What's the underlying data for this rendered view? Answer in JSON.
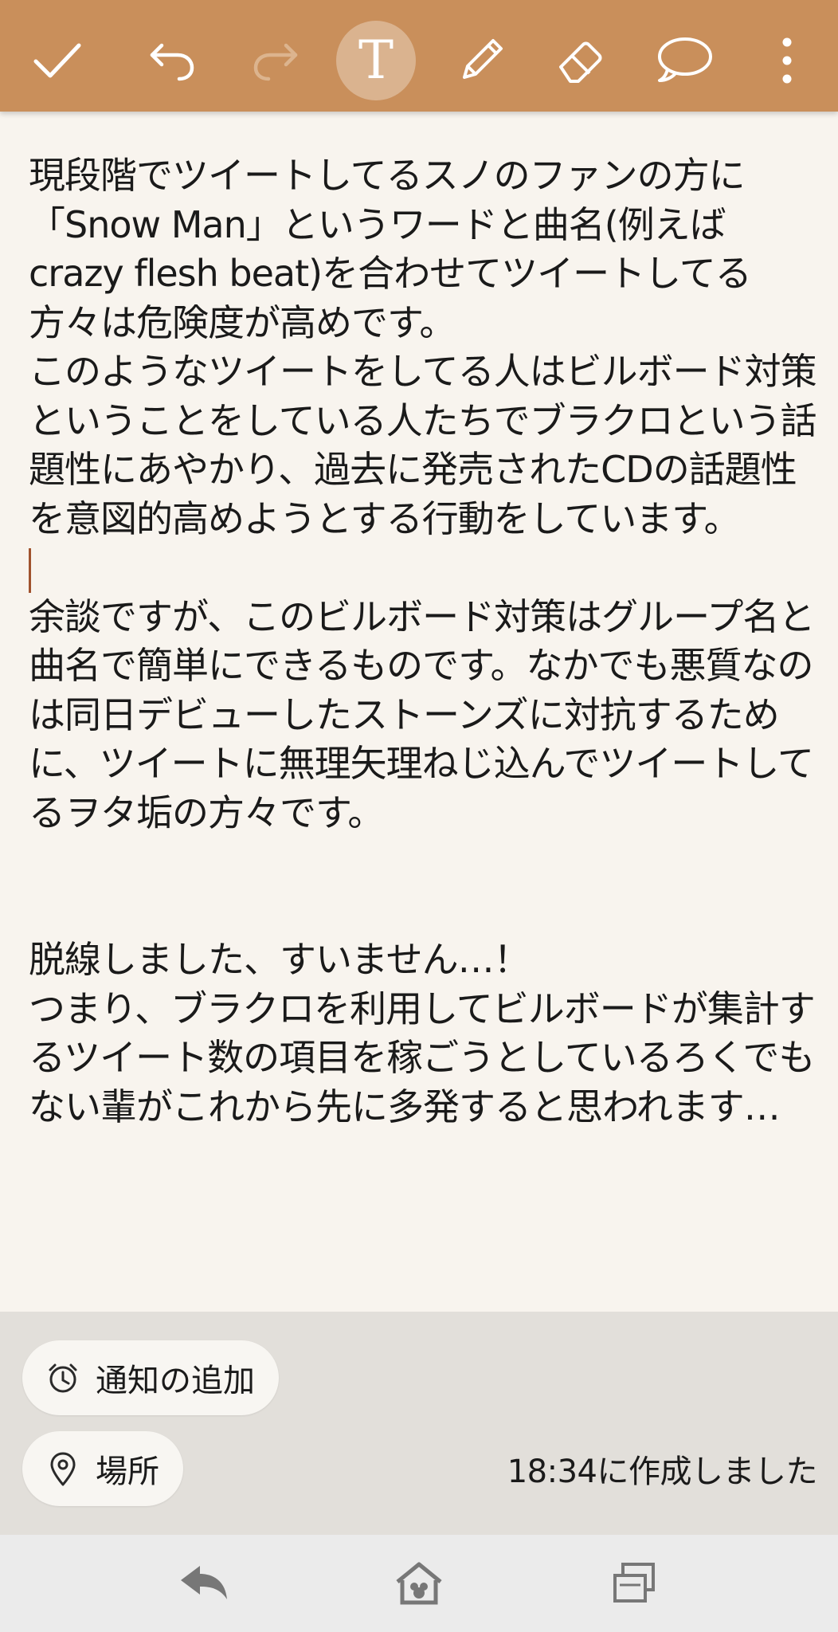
{
  "toolbar": {
    "icons": [
      "check-icon",
      "undo-icon",
      "redo-icon",
      "text-icon",
      "pencil-icon",
      "eraser-icon",
      "speech-bubble-icon",
      "more-vertical-icon"
    ],
    "text_tool_label": "T"
  },
  "note": {
    "paragraph1": "現段階でツイートしてるスノのファンの方に「Snow Man」というワードと曲名(例えばcrazy flesh beat)を合わせてツイートしてる方々は危険度が高めです。",
    "paragraph2": "このようなツイートをしてる人はビルボード対策ということをしている人たちでブラクロという話題性にあやかり、過去に発売されたCDの話題性を意図的高めようとする行動をしています。",
    "paragraph3": "余談ですが、このビルボード対策はグループ名と曲名で簡単にできるものです。なかでも悪質なのは同日デビューしたストーンズに対抗するために、ツイートに無理矢理ねじ込んでツイートしてるヲタ垢の方々です。",
    "paragraph4": "脱線しました、すいません…！",
    "paragraph5": "つまり、ブラクロを利用してビルボードが集計するツイート数の項目を稼ごうとしているろくでもない輩がこれから先に多発すると思われます…"
  },
  "footer": {
    "add_notification_label": "通知の追加",
    "location_label": "場所",
    "created_text": "18:34に作成しました"
  },
  "navbar": {
    "icons": [
      "back-icon",
      "home-icon",
      "recent-apps-icon"
    ]
  },
  "colors": {
    "toolbar": "#c98f5b",
    "note_background": "#f8f4ee",
    "footer_background": "#e2dfda",
    "navbar_background": "#ebebeb",
    "cursor": "#a0522d"
  }
}
